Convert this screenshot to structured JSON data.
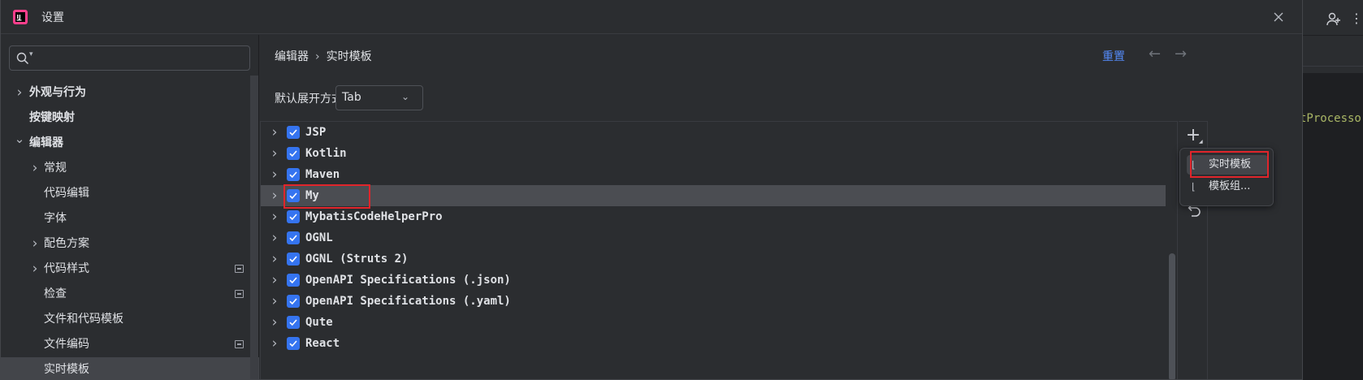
{
  "window": {
    "title": "设置"
  },
  "search": {
    "placeholder": "",
    "value": ""
  },
  "sidebar": {
    "items": [
      {
        "label": "外观与行为",
        "level": 0,
        "expandable": true,
        "expanded": false,
        "bold": true
      },
      {
        "label": "按键映射",
        "level": 0,
        "expandable": false,
        "bold": true
      },
      {
        "label": "编辑器",
        "level": 0,
        "expandable": true,
        "expanded": true,
        "bold": true
      },
      {
        "label": "常规",
        "level": 1,
        "expandable": true,
        "expanded": false
      },
      {
        "label": "代码编辑",
        "level": 1,
        "expandable": false
      },
      {
        "label": "字体",
        "level": 1,
        "expandable": false
      },
      {
        "label": "配色方案",
        "level": 1,
        "expandable": true,
        "expanded": false
      },
      {
        "label": "代码样式",
        "level": 1,
        "expandable": true,
        "expanded": false,
        "modified_icon": true
      },
      {
        "label": "检查",
        "level": 1,
        "expandable": false,
        "modified_icon": true
      },
      {
        "label": "文件和代码模板",
        "level": 1,
        "expandable": false
      },
      {
        "label": "文件编码",
        "level": 1,
        "expandable": false,
        "modified_icon": true
      },
      {
        "label": "实时模板",
        "level": 1,
        "expandable": false,
        "selected": true
      }
    ]
  },
  "breadcrumb": {
    "parent": "编辑器",
    "separator": "›",
    "current": "实时模板"
  },
  "header": {
    "reset_label": "重置",
    "back_icon": "←",
    "forward_icon": "→"
  },
  "expand": {
    "label": "默认展开方式",
    "value": "Tab"
  },
  "templates": [
    {
      "name": "JSP",
      "checked": true
    },
    {
      "name": "Kotlin",
      "checked": true
    },
    {
      "name": "Maven",
      "checked": true
    },
    {
      "name": "My",
      "checked": true,
      "highlight": true
    },
    {
      "name": "MybatisCodeHelperPro",
      "checked": true
    },
    {
      "name": "OGNL",
      "checked": true
    },
    {
      "name": "OGNL (Struts 2)",
      "checked": true
    },
    {
      "name": "OpenAPI Specifications (.json)",
      "checked": true
    },
    {
      "name": "OpenAPI Specifications (.yaml)",
      "checked": true
    },
    {
      "name": "Qute",
      "checked": true
    },
    {
      "name": "React",
      "checked": true
    }
  ],
  "popup": {
    "items": [
      {
        "label": "实时模板",
        "selected": true
      },
      {
        "label": "模板组..."
      }
    ]
  },
  "background_ide": {
    "code_snippet": "tProcessor"
  },
  "colors": {
    "accent": "#3574f0",
    "link": "#548af7",
    "annotation_red": "#e0252b",
    "background": "#2b2d30"
  }
}
